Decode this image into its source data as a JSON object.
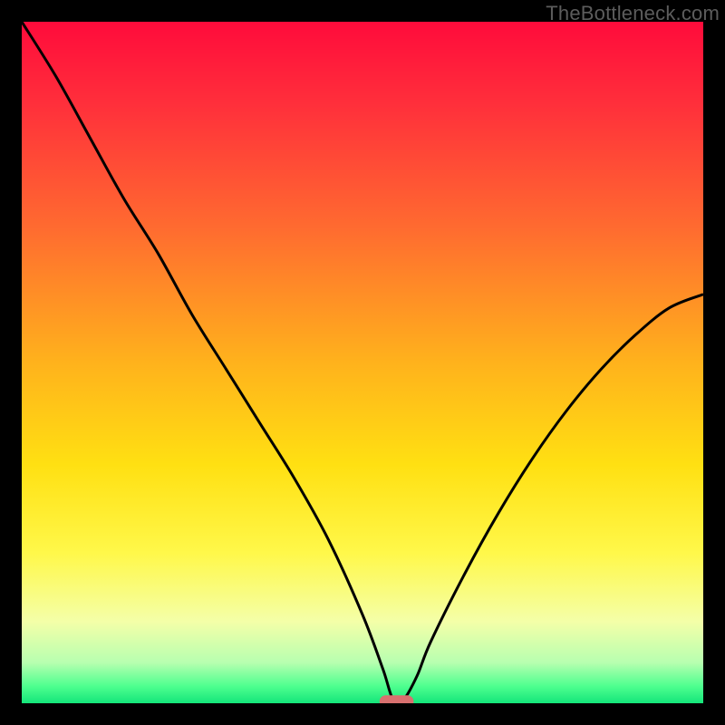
{
  "watermark": "TheBottleneck.com",
  "chart_data": {
    "type": "line",
    "title": "",
    "xlabel": "",
    "ylabel": "",
    "xlim": [
      0,
      100
    ],
    "ylim": [
      0,
      100
    ],
    "background_gradient": {
      "stops": [
        {
          "pos": 0.0,
          "color": "#ff0b3b"
        },
        {
          "pos": 0.12,
          "color": "#ff2f3b"
        },
        {
          "pos": 0.3,
          "color": "#ff6a30"
        },
        {
          "pos": 0.5,
          "color": "#ffb21c"
        },
        {
          "pos": 0.65,
          "color": "#ffe012"
        },
        {
          "pos": 0.78,
          "color": "#fff84a"
        },
        {
          "pos": 0.88,
          "color": "#f4ffa8"
        },
        {
          "pos": 0.94,
          "color": "#b8ffb0"
        },
        {
          "pos": 0.975,
          "color": "#4eff8f"
        },
        {
          "pos": 1.0,
          "color": "#14e57a"
        }
      ]
    },
    "series": [
      {
        "name": "bottleneck-curve",
        "color": "#000000",
        "x": [
          0,
          5,
          10,
          15,
          20,
          25,
          30,
          35,
          40,
          45,
          50,
          53,
          54.5,
          56,
          58,
          60,
          65,
          70,
          75,
          80,
          85,
          90,
          95,
          100
        ],
        "y": [
          100,
          92,
          83,
          74,
          66,
          57,
          49,
          41,
          33,
          24,
          13,
          5,
          0.5,
          0.5,
          4,
          9,
          19,
          28,
          36,
          43,
          49,
          54,
          58,
          60
        ]
      }
    ],
    "marker": {
      "name": "optimum-marker",
      "shape": "pill",
      "x": 55,
      "y": 0,
      "width_pct": 5,
      "height_pct": 1.8,
      "color": "#d8706f"
    }
  }
}
